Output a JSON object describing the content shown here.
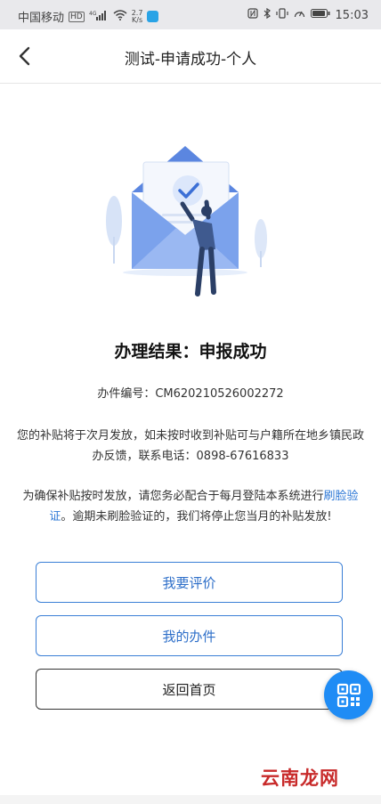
{
  "status_bar": {
    "carrier": "中国移动",
    "hd_badge": "HD",
    "network": "4G",
    "speed_value": "2.7",
    "speed_unit": "K/s",
    "time": "15:03",
    "icons": [
      "nfc-icon",
      "bluetooth-icon",
      "vibrate-icon",
      "gauge-icon",
      "battery-icon"
    ]
  },
  "navbar": {
    "back_icon": "chevron-left-icon",
    "title": "测试-申请成功-个人"
  },
  "illustration": "envelope-success-icon",
  "result": {
    "title": "办理结果：申报成功",
    "case_label": "办件编号：",
    "case_number": "CM620210526002272"
  },
  "notice": {
    "line1": "您的补贴将于次月发放，如未按时收到补贴可与户籍所在地乡镇民政办反馈，联系电话：",
    "phone": "0898-67616833",
    "line2_prefix": "为确保补贴按时发放，请您务必配合于每月登陆本系统进行",
    "line2_link": "刷脸验证",
    "line2_suffix": "。逾期未刷脸验证的，我们将停止您当月的补贴发放!"
  },
  "buttons": {
    "evaluate": "我要评价",
    "my_cases": "我的办件",
    "home": "返回首页"
  },
  "fab_icon": "qr-code-icon",
  "watermark": "云南龙网",
  "colors": {
    "accent": "#2e78d6",
    "fab": "#1f8cf5",
    "status_bar": "#e9e9ec"
  }
}
